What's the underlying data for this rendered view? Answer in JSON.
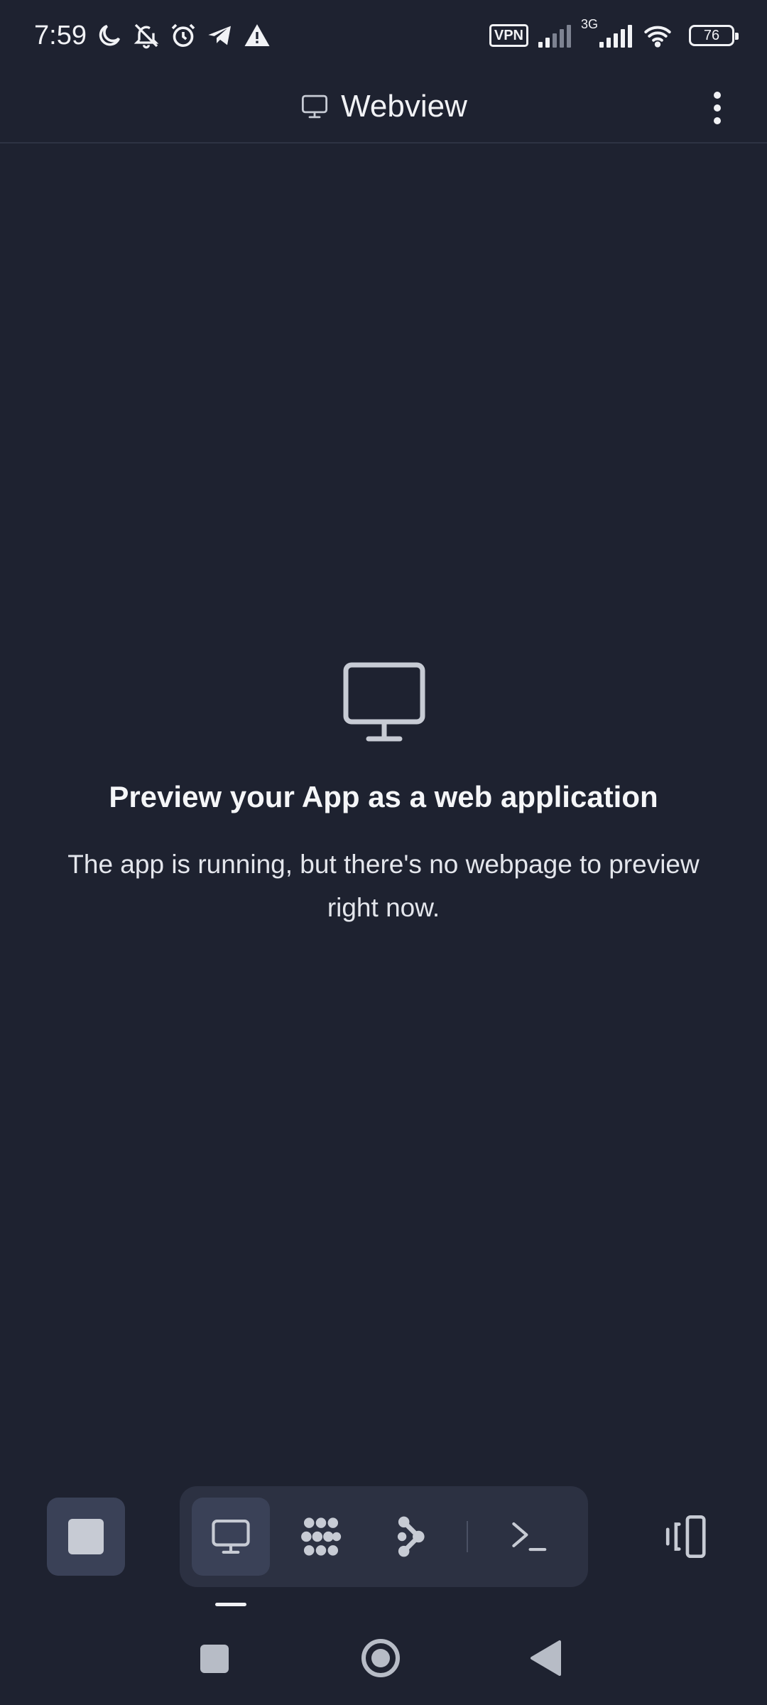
{
  "status_bar": {
    "time": "7:59",
    "icons": [
      "moon-icon",
      "bell-off-icon",
      "alarm-icon",
      "telegram-icon",
      "warning-icon"
    ],
    "vpn_label": "VPN",
    "network_label": "3G",
    "battery_level": "76"
  },
  "header": {
    "title": "Webview",
    "icon": "monitor-icon",
    "menu_icon": "kebab-menu-icon"
  },
  "empty_state": {
    "icon": "monitor-icon",
    "title": "Preview your App as a web application",
    "description": "The app is running, but there's no webpage to preview right now."
  },
  "toolbar": {
    "stop_icon": "stop-icon",
    "tools": [
      "webview-tool",
      "modules-tool",
      "graph-tool",
      "terminal-tool"
    ],
    "active_tool": "webview-tool",
    "devices_icon": "devices-icon"
  },
  "colors": {
    "background": "#1e2230",
    "surface": "#2c3142",
    "active": "#3a4157",
    "text": "#f1f2f5",
    "icon": "#c7cbd4"
  }
}
